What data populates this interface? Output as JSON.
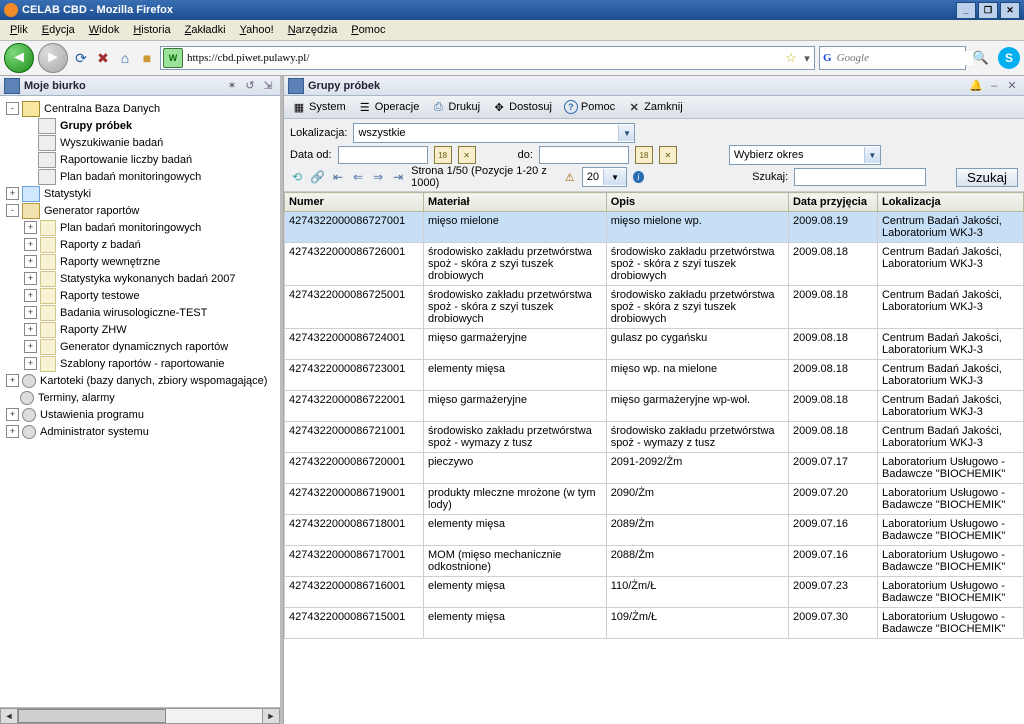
{
  "window": {
    "title": "CELAB CBD - Mozilla Firefox"
  },
  "menu": [
    "Plik",
    "Edycja",
    "Widok",
    "Historia",
    "Zakładki",
    "Yahoo!",
    "Narzędzia",
    "Pomoc"
  ],
  "url": "https://cbd.piwet.pulawy.pl/",
  "search_placeholder": "Google",
  "left": {
    "title": "Moje biurko",
    "nodes": [
      {
        "ind": 0,
        "exp": "-",
        "ico": "db",
        "label": "Centralna Baza Danych",
        "bold": false
      },
      {
        "ind": 1,
        "exp": "",
        "ico": "doc",
        "label": "Grupy próbek",
        "bold": true
      },
      {
        "ind": 1,
        "exp": "",
        "ico": "doc",
        "label": "Wyszukiwanie badań"
      },
      {
        "ind": 1,
        "exp": "",
        "ico": "doc",
        "label": "Raportowanie liczby badań"
      },
      {
        "ind": 1,
        "exp": "",
        "ico": "doc",
        "label": "Plan badań monitoringowych"
      },
      {
        "ind": 0,
        "exp": "+",
        "ico": "stat",
        "label": "Statystyki"
      },
      {
        "ind": 0,
        "exp": "-",
        "ico": "gen",
        "label": "Generator raportów"
      },
      {
        "ind": 1,
        "exp": "+",
        "ico": "sub",
        "label": "Plan badań monitoringowych"
      },
      {
        "ind": 1,
        "exp": "+",
        "ico": "sub",
        "label": "Raporty z badań"
      },
      {
        "ind": 1,
        "exp": "+",
        "ico": "sub",
        "label": "Raporty wewnętrzne"
      },
      {
        "ind": 1,
        "exp": "+",
        "ico": "sub",
        "label": "Statystyka wykonanych badań 2007"
      },
      {
        "ind": 1,
        "exp": "+",
        "ico": "sub",
        "label": "Raporty testowe"
      },
      {
        "ind": 1,
        "exp": "+",
        "ico": "sub",
        "label": "Badania wirusologiczne-TEST"
      },
      {
        "ind": 1,
        "exp": "+",
        "ico": "sub",
        "label": "Raporty ZHW"
      },
      {
        "ind": 1,
        "exp": "+",
        "ico": "sub",
        "label": "Generator dynamicznych raportów"
      },
      {
        "ind": 1,
        "exp": "+",
        "ico": "sub",
        "label": "Szablony raportów - raportowanie"
      },
      {
        "ind": 0,
        "exp": "+",
        "ico": "gear",
        "label": "Kartoteki (bazy danych, zbiory wspomagające)"
      },
      {
        "ind": 0,
        "exp": "",
        "ico": "gear",
        "label": "Terminy, alarmy"
      },
      {
        "ind": 0,
        "exp": "+",
        "ico": "gear",
        "label": "Ustawienia programu"
      },
      {
        "ind": 0,
        "exp": "+",
        "ico": "gear",
        "label": "Administrator systemu"
      }
    ]
  },
  "right": {
    "title": "Grupy próbek",
    "toolbar": [
      "System",
      "Operacje",
      "Drukuj",
      "Dostosuj",
      "Pomoc",
      "Zamknij"
    ],
    "filters": {
      "loc_label": "Lokalizacja:",
      "loc_value": "wszystkie",
      "date_from_label": "Data od:",
      "date_to_label": "do:",
      "period_value": "Wybierz okres",
      "page_info": "Strona 1/50 (Pozycje 1-20 z 1000)",
      "page_size": "20",
      "search_label": "Szukaj:",
      "search_btn": "Szukaj"
    },
    "columns": [
      "Numer",
      "Materiał",
      "Opis",
      "Data przyjęcia",
      "Lokalizacja"
    ],
    "rows": [
      {
        "sel": true,
        "num": "4274322000086727001",
        "mat": "mięso mielone",
        "opis": "mięso mielone wp.",
        "data": "2009.08.19",
        "lok": "Centrum Badań Jakości, Laboratorium WKJ-3"
      },
      {
        "num": "4274322000086726001",
        "mat": "środowisko zakładu przetwórstwa spoż - skóra z szyi tuszek drobiowych",
        "opis": "środowisko zakładu przetwórstwa spoż - skóra z szyi tuszek drobiowych",
        "data": "2009.08.18",
        "lok": "Centrum Badań Jakości, Laboratorium WKJ-3"
      },
      {
        "num": "4274322000086725001",
        "mat": "środowisko zakładu przetwórstwa spoż - skóra z szyi tuszek drobiowych",
        "opis": "środowisko zakładu przetwórstwa spoż - skóra z szyi tuszek drobiowych",
        "data": "2009.08.18",
        "lok": "Centrum Badań Jakości, Laboratorium WKJ-3"
      },
      {
        "num": "4274322000086724001",
        "mat": "mięso garmażeryjne",
        "opis": "gulasz po cygańsku",
        "data": "2009.08.18",
        "lok": "Centrum Badań Jakości, Laboratorium WKJ-3"
      },
      {
        "num": "4274322000086723001",
        "mat": "elementy mięsa",
        "opis": "mięso wp. na mielone",
        "data": "2009.08.18",
        "lok": "Centrum Badań Jakości, Laboratorium WKJ-3"
      },
      {
        "num": "4274322000086722001",
        "mat": "mięso garmażeryjne",
        "opis": "mięso garmażeryjne wp-woł.",
        "data": "2009.08.18",
        "lok": "Centrum Badań Jakości, Laboratorium WKJ-3"
      },
      {
        "num": "4274322000086721001",
        "mat": "środowisko zakładu przetwórstwa spoż - wymazy z tusz",
        "opis": "środowisko zakładu przetwórstwa spoż - wymazy z tusz",
        "data": "2009.08.18",
        "lok": "Centrum Badań Jakości, Laboratorium WKJ-3"
      },
      {
        "num": "4274322000086720001",
        "mat": "pieczywo",
        "opis": "2091-2092/Żm",
        "data": "2009.07.17",
        "lok": "Laboratorium Usługowo - Badawcze \"BIOCHEMIK\""
      },
      {
        "num": "4274322000086719001",
        "mat": "produkty mleczne mrożone (w tym lody)",
        "opis": "2090/Żm",
        "data": "2009.07.20",
        "lok": "Laboratorium Usługowo - Badawcze \"BIOCHEMIK\""
      },
      {
        "num": "4274322000086718001",
        "mat": "elementy mięsa",
        "opis": "2089/Żm",
        "data": "2009.07.16",
        "lok": "Laboratorium Usługowo - Badawcze \"BIOCHEMIK\""
      },
      {
        "num": "4274322000086717001",
        "mat": "MOM (mięso mechanicznie odkostnione)",
        "opis": "2088/Żm",
        "data": "2009.07.16",
        "lok": "Laboratorium Usługowo - Badawcze \"BIOCHEMIK\""
      },
      {
        "num": "4274322000086716001",
        "mat": "elementy mięsa",
        "opis": "110/Żm/Ł",
        "data": "2009.07.23",
        "lok": "Laboratorium Usługowo - Badawcze \"BIOCHEMIK\""
      },
      {
        "num": "4274322000086715001",
        "mat": "elementy mięsa",
        "opis": "109/Żm/Ł",
        "data": "2009.07.30",
        "lok": "Laboratorium Usługowo - Badawcze \"BIOCHEMIK\""
      }
    ]
  }
}
